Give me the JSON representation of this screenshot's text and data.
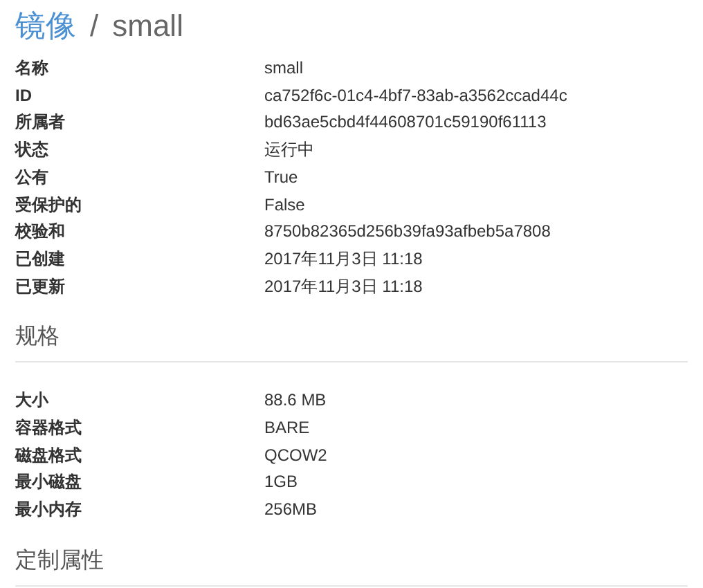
{
  "breadcrumb": {
    "parent": "镜像",
    "separator": "/",
    "current": "small"
  },
  "overview": [
    {
      "label": "名称",
      "value": "small"
    },
    {
      "label": "ID",
      "value": "ca752f6c-01c4-4bf7-83ab-a3562ccad44c"
    },
    {
      "label": "所属者",
      "value": "bd63ae5cbd4f44608701c59190f61113"
    },
    {
      "label": "状态",
      "value": "运行中"
    },
    {
      "label": "公有",
      "value": "True"
    },
    {
      "label": "受保护的",
      "value": "False"
    },
    {
      "label": "校验和",
      "value": "8750b82365d256b39fa93afbeb5a7808"
    },
    {
      "label": "已创建",
      "value": "2017年11月3日 11:18"
    },
    {
      "label": "已更新",
      "value": "2017年11月3日 11:18"
    }
  ],
  "sections": [
    {
      "title": "规格",
      "rows": [
        {
          "label": "大小",
          "value": "88.6 MB"
        },
        {
          "label": "容器格式",
          "value": "BARE"
        },
        {
          "label": "磁盘格式",
          "value": "QCOW2"
        },
        {
          "label": "最小磁盘",
          "value": "1GB"
        },
        {
          "label": "最小内存",
          "value": "256MB"
        }
      ]
    },
    {
      "title": "定制属性"
    }
  ]
}
